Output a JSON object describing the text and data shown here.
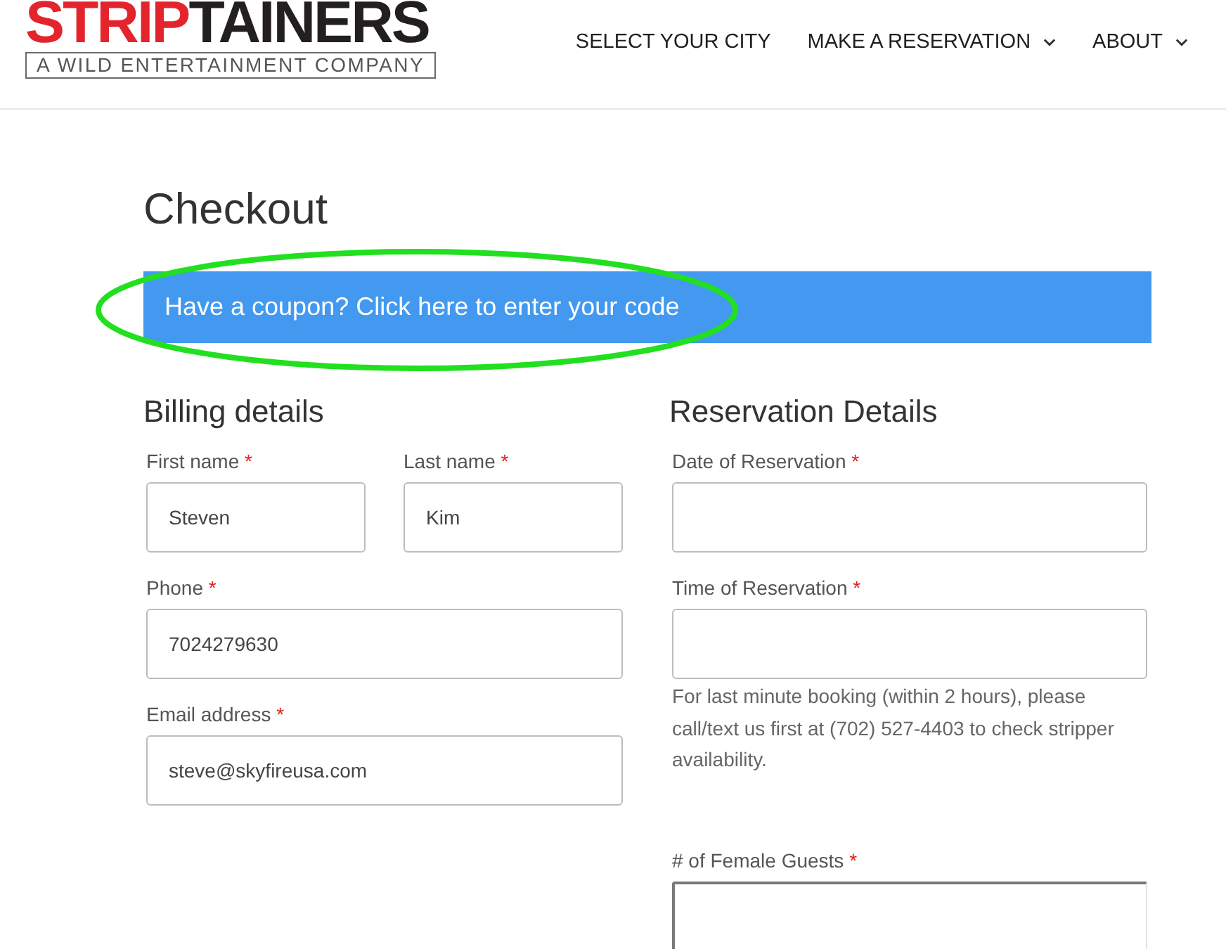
{
  "header": {
    "logo": {
      "accent_text": "STRIP",
      "text": "TAINERS",
      "tagline": "A WILD ENTERTAINMENT COMPANY"
    },
    "nav": [
      {
        "label": "SELECT YOUR CITY",
        "has_submenu": false
      },
      {
        "label": "MAKE A RESERVATION",
        "has_submenu": true
      },
      {
        "label": "ABOUT",
        "has_submenu": true
      }
    ]
  },
  "page_title": "Checkout",
  "coupon_notice": {
    "text": "Have a coupon? Click here to enter your code",
    "highlighted": true
  },
  "billing": {
    "title": "Billing details",
    "rows": [
      {
        "fields": [
          {
            "label": "First name",
            "required_mark": "*",
            "value": "Steven",
            "kind": "text"
          },
          {
            "label": "Last name",
            "required_mark": "*",
            "value": "Kim",
            "kind": "text"
          }
        ]
      },
      {
        "fields": [
          {
            "label": "Phone",
            "required_mark": "*",
            "value": "7024279630",
            "kind": "text"
          }
        ]
      },
      {
        "fields": [
          {
            "label": "Email address",
            "required_mark": "*",
            "value": "steve@skyfireusa.com",
            "kind": "text"
          }
        ]
      }
    ]
  },
  "reservation": {
    "title": "Reservation Details",
    "rows": [
      {
        "fields": [
          {
            "label": "Date of Reservation",
            "required_mark": "*",
            "kind": "text"
          }
        ]
      },
      {
        "fields": [
          {
            "label": "Time of Reservation",
            "required_mark": "*",
            "kind": "text",
            "note": "For last minute booking (within 2 hours), please call/text us first at (702) 527-4403 to check stripper availability."
          }
        ]
      },
      {
        "fields": [
          {
            "label": "# of Female Guests",
            "required_mark": "*",
            "kind": "number"
          }
        ]
      }
    ]
  }
}
